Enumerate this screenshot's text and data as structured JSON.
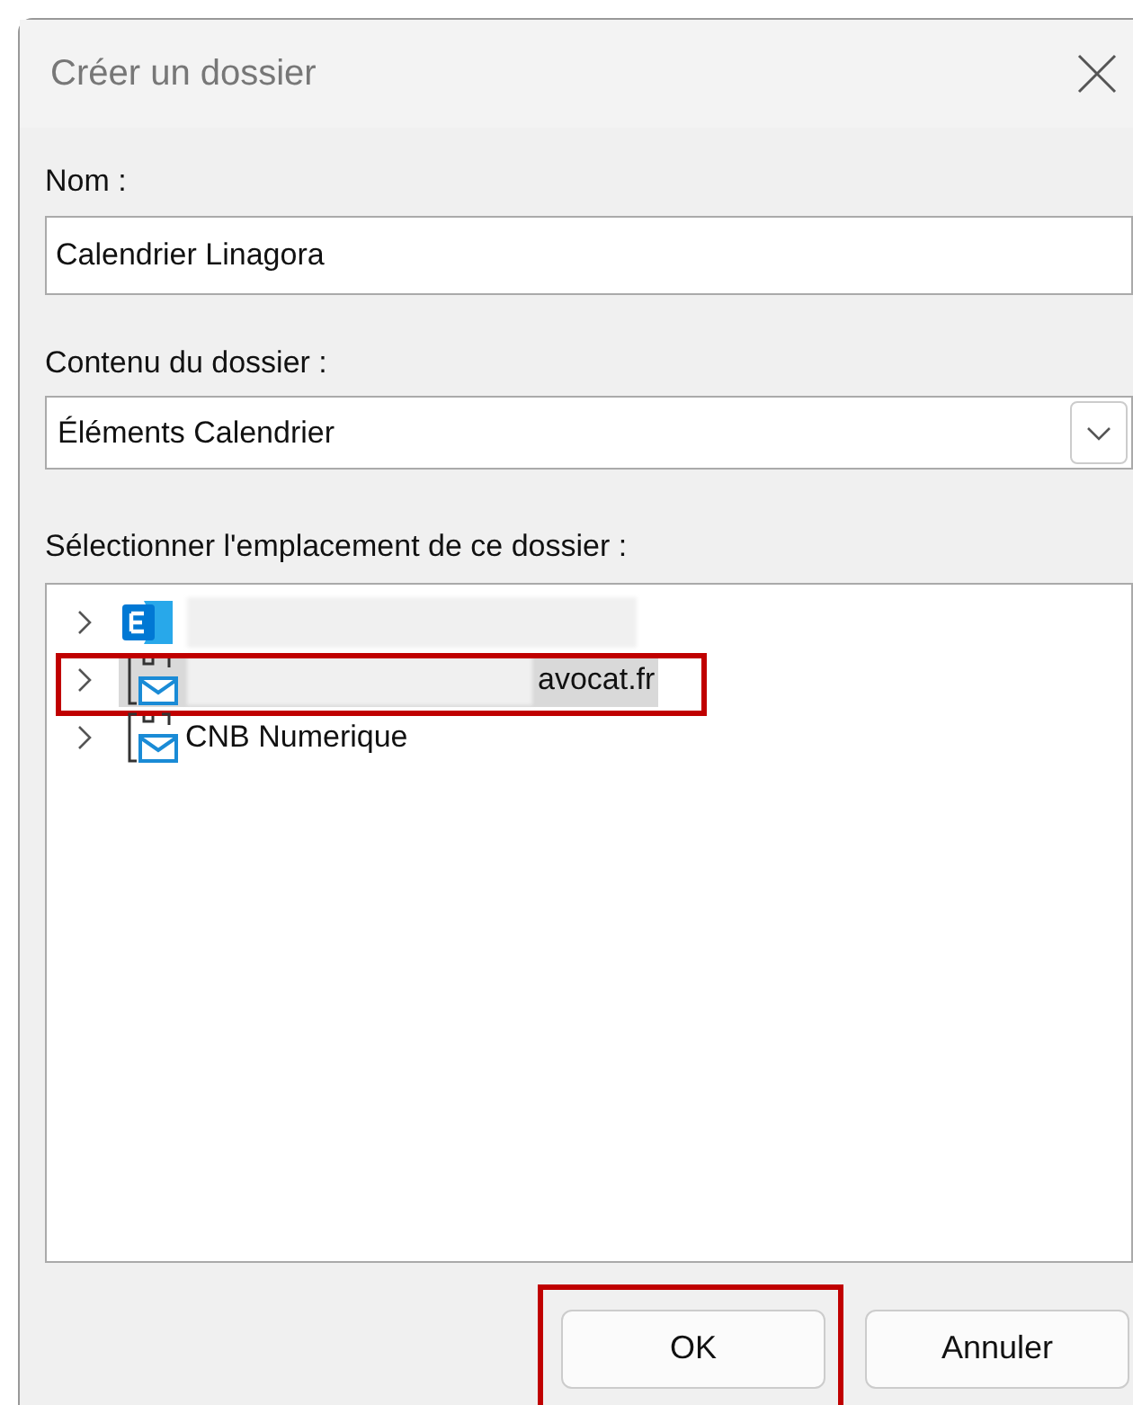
{
  "window": {
    "title": "Créer un dossier"
  },
  "name_field": {
    "label": "Nom :",
    "value": "Calendrier Linagora"
  },
  "content_field": {
    "label": "Contenu du dossier :",
    "value": "Éléments Calendrier"
  },
  "location": {
    "label": "Sélectionner l'emplacement de ce dossier :",
    "items": [
      {
        "kind": "exchange",
        "redacted": true,
        "selected": false,
        "highlighted": false
      },
      {
        "kind": "mailbox",
        "redacted": true,
        "label": "avocat.fr",
        "selected": true,
        "highlighted": true
      },
      {
        "kind": "mailbox",
        "redacted": false,
        "label": "CNB Numerique",
        "selected": false,
        "highlighted": false
      }
    ]
  },
  "buttons": [
    {
      "label": "OK",
      "highlighted": true
    },
    {
      "label": "Annuler",
      "highlighted": false
    }
  ]
}
